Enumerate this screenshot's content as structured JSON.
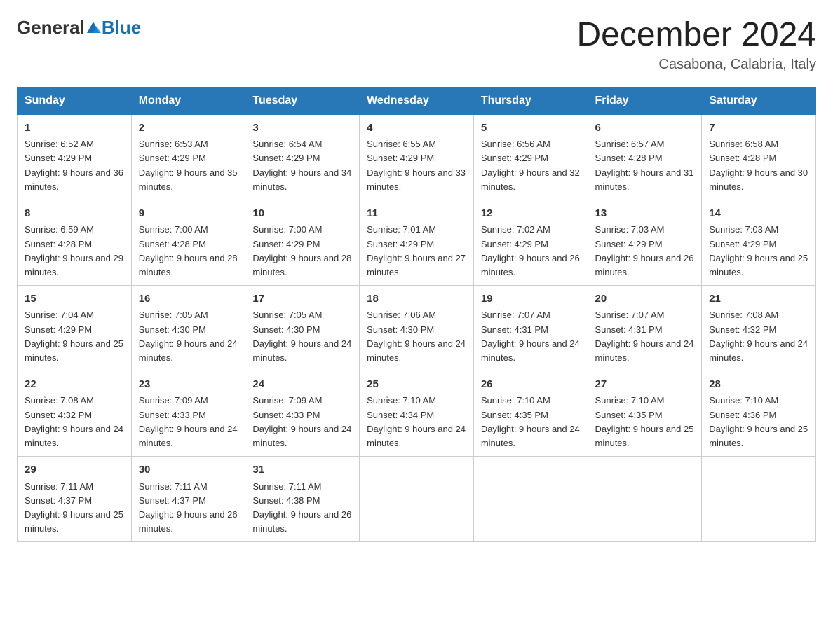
{
  "header": {
    "logo_general": "General",
    "logo_blue": "Blue",
    "month_title": "December 2024",
    "location": "Casabona, Calabria, Italy"
  },
  "weekdays": [
    "Sunday",
    "Monday",
    "Tuesday",
    "Wednesday",
    "Thursday",
    "Friday",
    "Saturday"
  ],
  "weeks": [
    [
      {
        "day": "1",
        "sunrise": "6:52 AM",
        "sunset": "4:29 PM",
        "daylight": "9 hours and 36 minutes."
      },
      {
        "day": "2",
        "sunrise": "6:53 AM",
        "sunset": "4:29 PM",
        "daylight": "9 hours and 35 minutes."
      },
      {
        "day": "3",
        "sunrise": "6:54 AM",
        "sunset": "4:29 PM",
        "daylight": "9 hours and 34 minutes."
      },
      {
        "day": "4",
        "sunrise": "6:55 AM",
        "sunset": "4:29 PM",
        "daylight": "9 hours and 33 minutes."
      },
      {
        "day": "5",
        "sunrise": "6:56 AM",
        "sunset": "4:29 PM",
        "daylight": "9 hours and 32 minutes."
      },
      {
        "day": "6",
        "sunrise": "6:57 AM",
        "sunset": "4:28 PM",
        "daylight": "9 hours and 31 minutes."
      },
      {
        "day": "7",
        "sunrise": "6:58 AM",
        "sunset": "4:28 PM",
        "daylight": "9 hours and 30 minutes."
      }
    ],
    [
      {
        "day": "8",
        "sunrise": "6:59 AM",
        "sunset": "4:28 PM",
        "daylight": "9 hours and 29 minutes."
      },
      {
        "day": "9",
        "sunrise": "7:00 AM",
        "sunset": "4:28 PM",
        "daylight": "9 hours and 28 minutes."
      },
      {
        "day": "10",
        "sunrise": "7:00 AM",
        "sunset": "4:29 PM",
        "daylight": "9 hours and 28 minutes."
      },
      {
        "day": "11",
        "sunrise": "7:01 AM",
        "sunset": "4:29 PM",
        "daylight": "9 hours and 27 minutes."
      },
      {
        "day": "12",
        "sunrise": "7:02 AM",
        "sunset": "4:29 PM",
        "daylight": "9 hours and 26 minutes."
      },
      {
        "day": "13",
        "sunrise": "7:03 AM",
        "sunset": "4:29 PM",
        "daylight": "9 hours and 26 minutes."
      },
      {
        "day": "14",
        "sunrise": "7:03 AM",
        "sunset": "4:29 PM",
        "daylight": "9 hours and 25 minutes."
      }
    ],
    [
      {
        "day": "15",
        "sunrise": "7:04 AM",
        "sunset": "4:29 PM",
        "daylight": "9 hours and 25 minutes."
      },
      {
        "day": "16",
        "sunrise": "7:05 AM",
        "sunset": "4:30 PM",
        "daylight": "9 hours and 24 minutes."
      },
      {
        "day": "17",
        "sunrise": "7:05 AM",
        "sunset": "4:30 PM",
        "daylight": "9 hours and 24 minutes."
      },
      {
        "day": "18",
        "sunrise": "7:06 AM",
        "sunset": "4:30 PM",
        "daylight": "9 hours and 24 minutes."
      },
      {
        "day": "19",
        "sunrise": "7:07 AM",
        "sunset": "4:31 PM",
        "daylight": "9 hours and 24 minutes."
      },
      {
        "day": "20",
        "sunrise": "7:07 AM",
        "sunset": "4:31 PM",
        "daylight": "9 hours and 24 minutes."
      },
      {
        "day": "21",
        "sunrise": "7:08 AM",
        "sunset": "4:32 PM",
        "daylight": "9 hours and 24 minutes."
      }
    ],
    [
      {
        "day": "22",
        "sunrise": "7:08 AM",
        "sunset": "4:32 PM",
        "daylight": "9 hours and 24 minutes."
      },
      {
        "day": "23",
        "sunrise": "7:09 AM",
        "sunset": "4:33 PM",
        "daylight": "9 hours and 24 minutes."
      },
      {
        "day": "24",
        "sunrise": "7:09 AM",
        "sunset": "4:33 PM",
        "daylight": "9 hours and 24 minutes."
      },
      {
        "day": "25",
        "sunrise": "7:10 AM",
        "sunset": "4:34 PM",
        "daylight": "9 hours and 24 minutes."
      },
      {
        "day": "26",
        "sunrise": "7:10 AM",
        "sunset": "4:35 PM",
        "daylight": "9 hours and 24 minutes."
      },
      {
        "day": "27",
        "sunrise": "7:10 AM",
        "sunset": "4:35 PM",
        "daylight": "9 hours and 25 minutes."
      },
      {
        "day": "28",
        "sunrise": "7:10 AM",
        "sunset": "4:36 PM",
        "daylight": "9 hours and 25 minutes."
      }
    ],
    [
      {
        "day": "29",
        "sunrise": "7:11 AM",
        "sunset": "4:37 PM",
        "daylight": "9 hours and 25 minutes."
      },
      {
        "day": "30",
        "sunrise": "7:11 AM",
        "sunset": "4:37 PM",
        "daylight": "9 hours and 26 minutes."
      },
      {
        "day": "31",
        "sunrise": "7:11 AM",
        "sunset": "4:38 PM",
        "daylight": "9 hours and 26 minutes."
      },
      null,
      null,
      null,
      null
    ]
  ]
}
